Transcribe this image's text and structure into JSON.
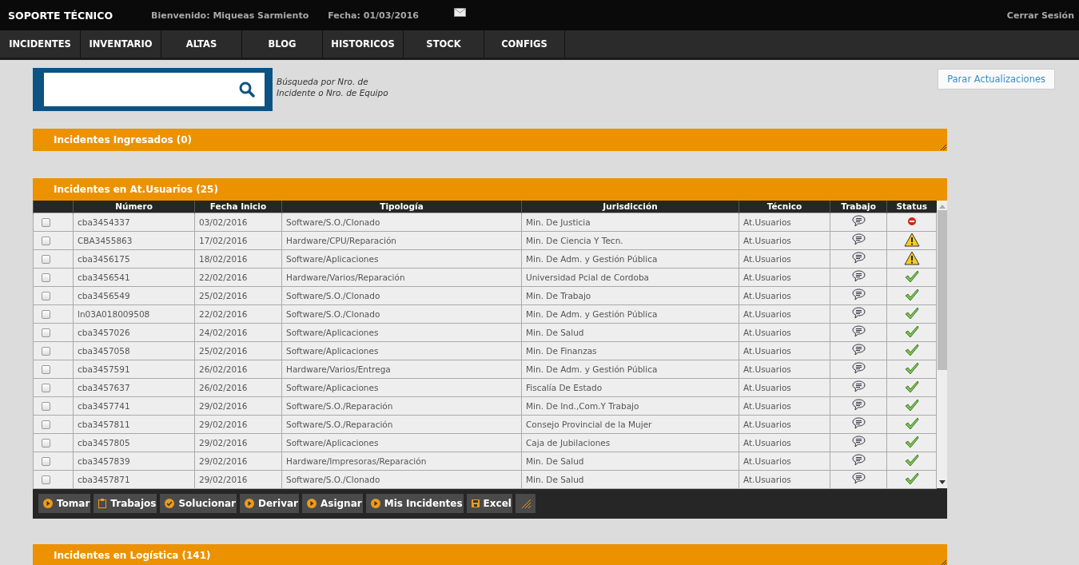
{
  "header": {
    "title": "SOPORTE TÉCNICO",
    "welcome": "Bienvenido: Miqueas Sarmiento",
    "date": "Fecha: 01/03/2016",
    "logout": "Cerrar Sesión"
  },
  "nav": [
    {
      "label": "INCIDENTES"
    },
    {
      "label": "INVENTARIO"
    },
    {
      "label": "ALTAS"
    },
    {
      "label": "BLOG"
    },
    {
      "label": "HISTORICOS"
    },
    {
      "label": "STOCK"
    },
    {
      "label": "CONFIGS"
    }
  ],
  "search": {
    "hint": "Búsqueda por Nro. de Incidente o Nro. de Equipo"
  },
  "stop_button": "Parar Actualizaciones",
  "panels": [
    {
      "title": "Incidentes Ingresados (0)",
      "kind": "collapsed"
    },
    {
      "title": "Incidentes en At.Usuarios (25)",
      "kind": "table"
    },
    {
      "title": "Incidentes en Logística (141)",
      "kind": "collapsed"
    }
  ],
  "table": {
    "columns": [
      "Número",
      "Fecha Inicio",
      "Tipología",
      "Jurisdicción",
      "Técnico",
      "Trabajo",
      "Status"
    ],
    "rows": [
      {
        "checked": false,
        "numero": "cba3454337",
        "fecha": "03/02/2016",
        "tipologia": "Software/S.O./Clonado",
        "jurisdiccion": "Min. De Justicia",
        "tecnico": "At.Usuarios",
        "kind": "error"
      },
      {
        "checked": false,
        "numero": "CBA3455863",
        "fecha": "17/02/2016",
        "tipologia": "Hardware/CPU/Reparación",
        "jurisdiccion": "Min. De Ciencia Y Tecn.",
        "tecnico": "At.Usuarios",
        "kind": "warning"
      },
      {
        "checked": false,
        "numero": "cba3456175",
        "fecha": "18/02/2016",
        "tipologia": "Software/Aplicaciones",
        "jurisdiccion": "Min. De Adm. y Gestión Pública",
        "tecnico": "At.Usuarios",
        "kind": "warning"
      },
      {
        "checked": false,
        "numero": "cba3456541",
        "fecha": "22/02/2016",
        "tipologia": "Hardware/Varios/Reparación",
        "jurisdiccion": "Universidad Pcial de Cordoba",
        "tecnico": "At.Usuarios",
        "kind": "ok"
      },
      {
        "checked": false,
        "numero": "cba3456549",
        "fecha": "25/02/2016",
        "tipologia": "Software/S.O./Clonado",
        "jurisdiccion": "Min. De Trabajo",
        "tecnico": "At.Usuarios",
        "kind": "ok"
      },
      {
        "checked": false,
        "numero": "ln03A018009508",
        "fecha": "22/02/2016",
        "tipologia": "Software/S.O./Clonado",
        "jurisdiccion": "Min. De Adm. y Gestión Pública",
        "tecnico": "At.Usuarios",
        "kind": "ok"
      },
      {
        "checked": false,
        "numero": "cba3457026",
        "fecha": "24/02/2016",
        "tipologia": "Software/Aplicaciones",
        "jurisdiccion": "Min. De Salud",
        "tecnico": "At.Usuarios",
        "kind": "ok"
      },
      {
        "checked": false,
        "numero": "cba3457058",
        "fecha": "25/02/2016",
        "tipologia": "Software/Aplicaciones",
        "jurisdiccion": "Min. De Finanzas",
        "tecnico": "At.Usuarios",
        "kind": "ok"
      },
      {
        "checked": false,
        "numero": "cba3457591",
        "fecha": "26/02/2016",
        "tipologia": "Hardware/Varios/Entrega",
        "jurisdiccion": "Min. De Adm. y Gestión Pública",
        "tecnico": "At.Usuarios",
        "kind": "ok"
      },
      {
        "checked": false,
        "numero": "cba3457637",
        "fecha": "26/02/2016",
        "tipologia": "Software/Aplicaciones",
        "jurisdiccion": "Fiscalía De Estado",
        "tecnico": "At.Usuarios",
        "kind": "ok"
      },
      {
        "checked": false,
        "numero": "cba3457741",
        "fecha": "29/02/2016",
        "tipologia": "Software/S.O./Reparación",
        "jurisdiccion": "Min. De Ind.,Com.Y Trabajo",
        "tecnico": "At.Usuarios",
        "kind": "ok"
      },
      {
        "checked": false,
        "numero": "cba3457811",
        "fecha": "29/02/2016",
        "tipologia": "Software/S.O./Reparación",
        "jurisdiccion": "Consejo Provincial de la Mujer",
        "tecnico": "At.Usuarios",
        "kind": "ok"
      },
      {
        "checked": false,
        "numero": "cba3457805",
        "fecha": "29/02/2016",
        "tipologia": "Software/Aplicaciones",
        "jurisdiccion": "Caja de Jubilaciones",
        "tecnico": "At.Usuarios",
        "kind": "ok"
      },
      {
        "checked": false,
        "numero": "cba3457839",
        "fecha": "29/02/2016",
        "tipologia": "Hardware/Impresoras/Reparación",
        "jurisdiccion": "Min. De Salud",
        "tecnico": "At.Usuarios",
        "kind": "ok"
      },
      {
        "checked": false,
        "numero": "cba3457871",
        "fecha": "29/02/2016",
        "tipologia": "Software/S.O./Clonado",
        "jurisdiccion": "Min. De Salud",
        "tecnico": "At.Usuarios",
        "kind": "ok"
      }
    ]
  },
  "toolbar": [
    {
      "label": "Tomar",
      "kind": "play"
    },
    {
      "label": "Trabajos",
      "kind": "clipboard"
    },
    {
      "label": "Solucionar",
      "kind": "check"
    },
    {
      "label": "Derivar",
      "kind": "play"
    },
    {
      "label": "Asignar",
      "kind": "play"
    },
    {
      "label": "Mis Incidentes",
      "kind": "play"
    },
    {
      "label": "Excel",
      "kind": "save"
    },
    {
      "kind": "grip"
    }
  ]
}
